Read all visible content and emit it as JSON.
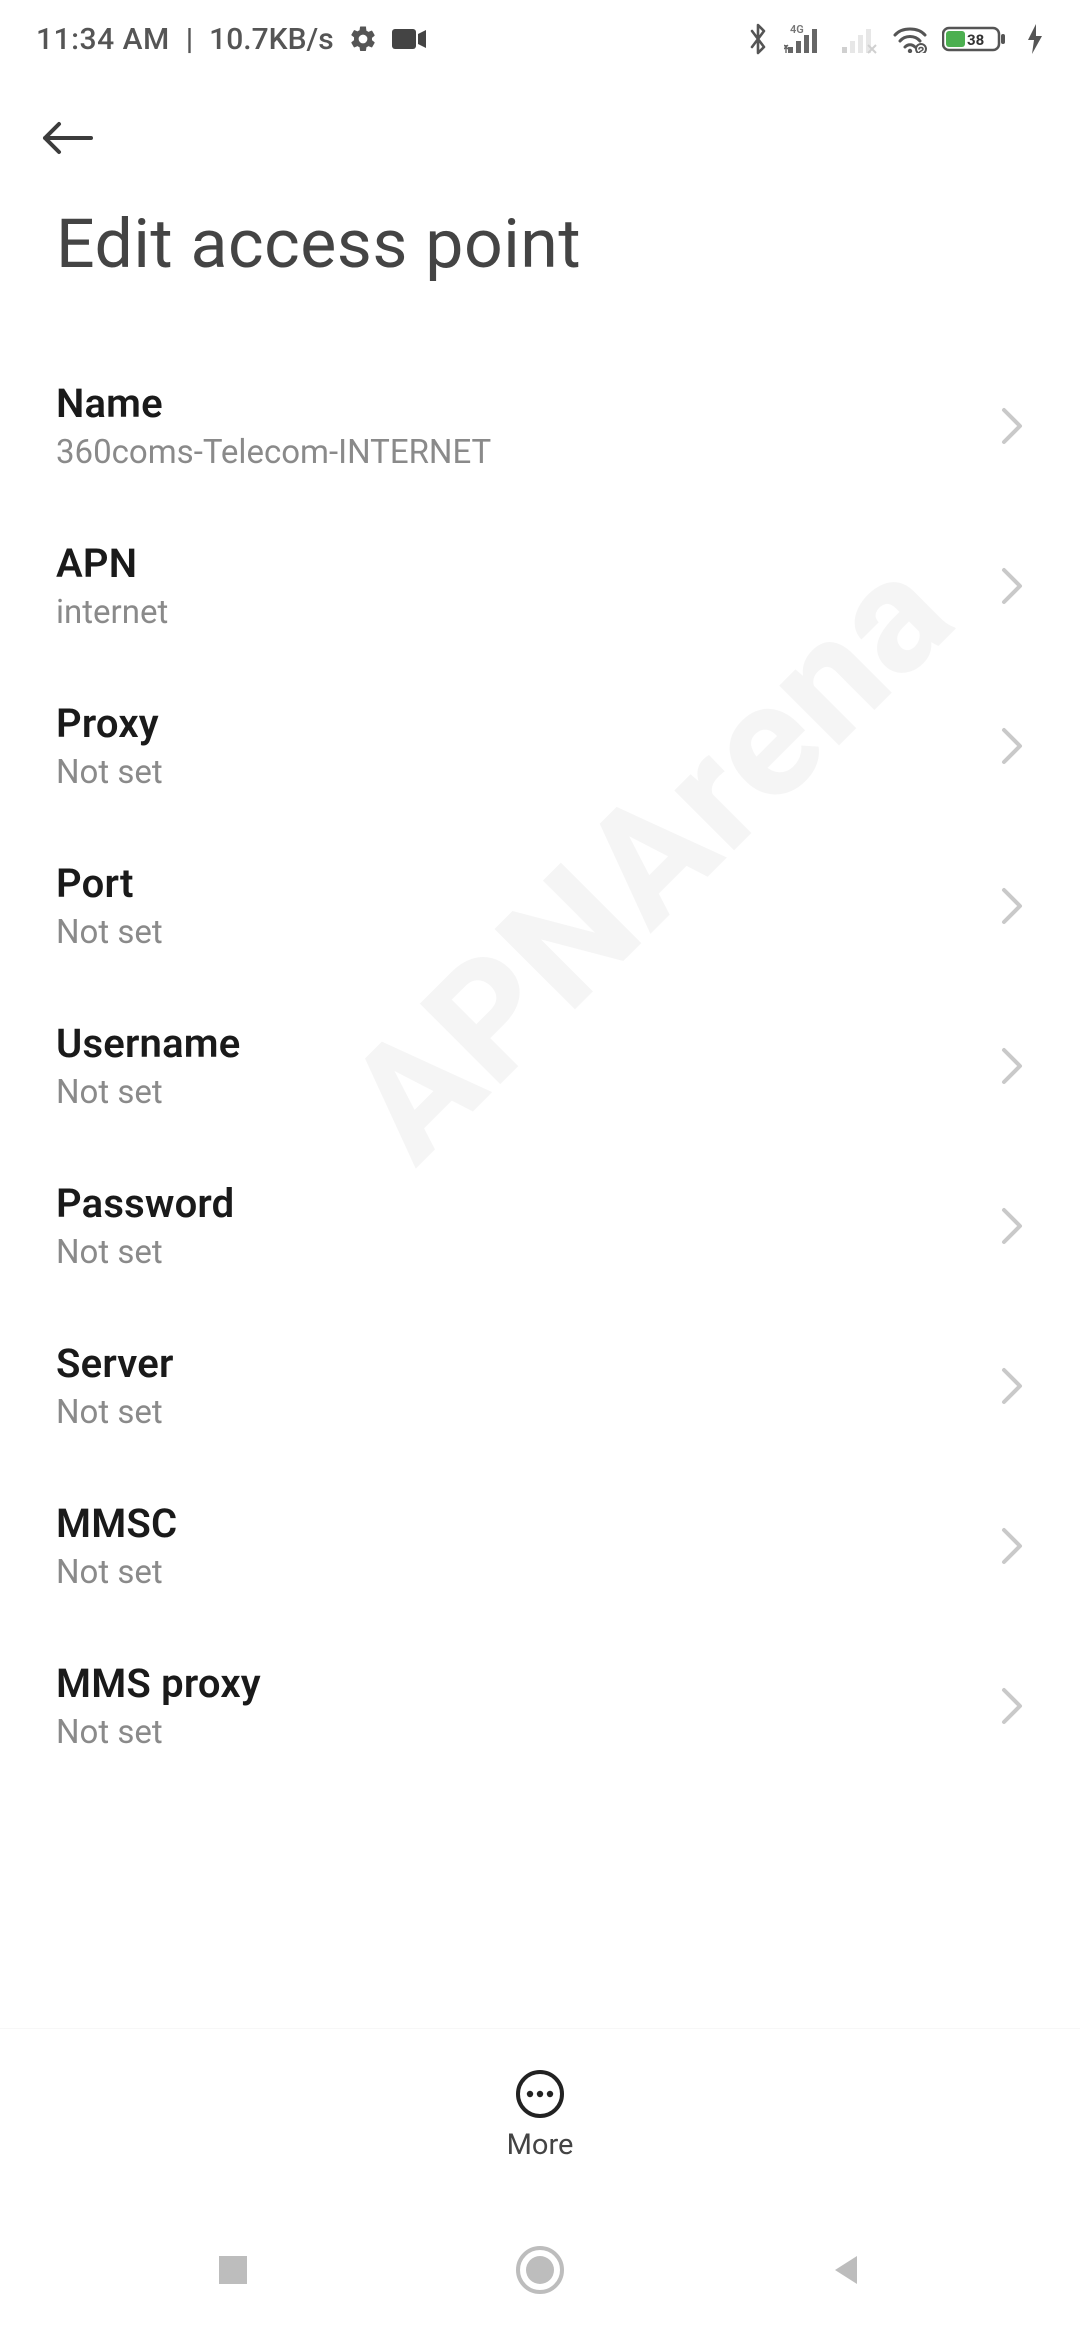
{
  "statusbar": {
    "time": "11:34 AM",
    "rate": "10.7KB/s",
    "battery_percent": "38"
  },
  "header": {
    "title": "Edit access point"
  },
  "rows": [
    {
      "title": "Name",
      "value": "360coms-Telecom-INTERNET"
    },
    {
      "title": "APN",
      "value": "internet"
    },
    {
      "title": "Proxy",
      "value": "Not set"
    },
    {
      "title": "Port",
      "value": "Not set"
    },
    {
      "title": "Username",
      "value": "Not set"
    },
    {
      "title": "Password",
      "value": "Not set"
    },
    {
      "title": "Server",
      "value": "Not set"
    },
    {
      "title": "MMSC",
      "value": "Not set"
    },
    {
      "title": "MMS proxy",
      "value": "Not set"
    }
  ],
  "bottom": {
    "more_label": "More"
  },
  "watermark": {
    "text": "APNArena"
  }
}
